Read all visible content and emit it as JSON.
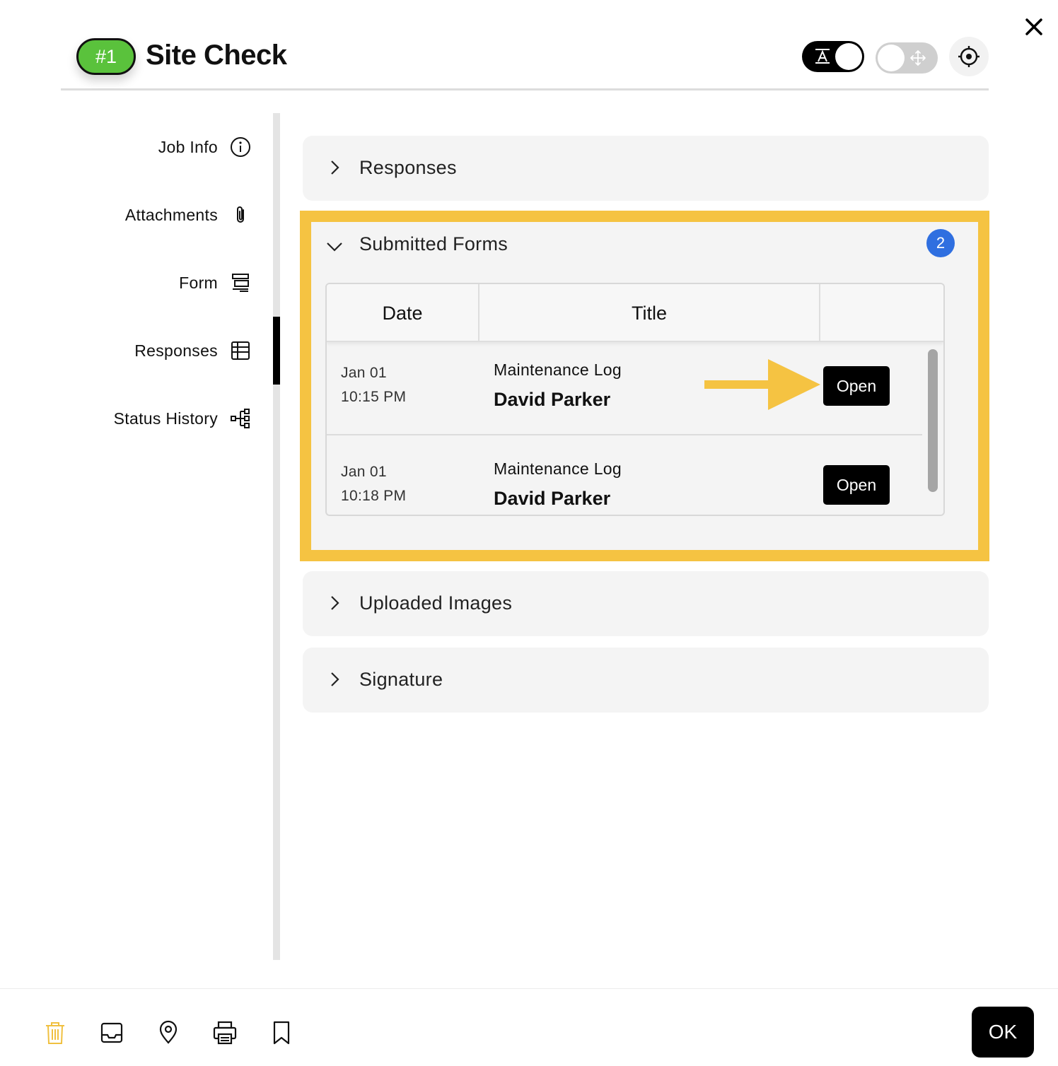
{
  "header": {
    "job_number": "#1",
    "title": "Site Check"
  },
  "toggles": {
    "text_mode": "on",
    "move_mode": "off"
  },
  "sidebar": {
    "items": [
      {
        "label": "Job Info",
        "icon": "info-icon"
      },
      {
        "label": "Attachments",
        "icon": "paperclip-icon"
      },
      {
        "label": "Form",
        "icon": "form-icon"
      },
      {
        "label": "Responses",
        "icon": "table-icon",
        "active": true
      },
      {
        "label": "Status History",
        "icon": "hierarchy-icon"
      }
    ]
  },
  "sections": {
    "responses": {
      "title": "Responses",
      "expanded": false
    },
    "submitted_forms": {
      "title": "Submitted Forms",
      "expanded": true,
      "count": "2",
      "columns": [
        "Date",
        "Title",
        ""
      ],
      "rows": [
        {
          "date": "Jan 01",
          "time": "10:15 PM",
          "form": "Maintenance Log",
          "name": "David Parker",
          "action": "Open"
        },
        {
          "date": "Jan 01",
          "time": "10:18 PM",
          "form": "Maintenance Log",
          "name": "David Parker",
          "action": "Open"
        }
      ]
    },
    "uploaded_images": {
      "title": "Uploaded Images",
      "expanded": false
    },
    "signature": {
      "title": "Signature",
      "expanded": false
    }
  },
  "footer": {
    "icons": [
      "trash-icon",
      "inbox-icon",
      "map-pin-icon",
      "print-icon",
      "bookmark-icon"
    ],
    "ok_label": "OK"
  },
  "colors": {
    "badge_green": "#5ac23c",
    "highlight_yellow": "#f5c342",
    "count_blue": "#2f6fe0",
    "trash_yellow": "#f0c040"
  }
}
